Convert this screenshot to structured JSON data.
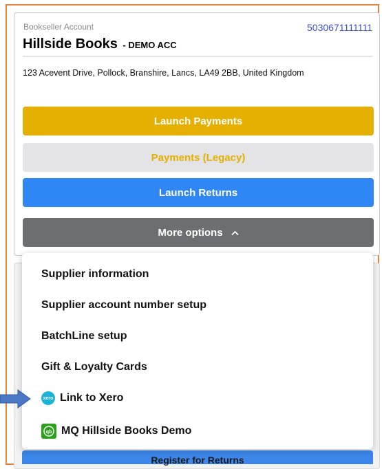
{
  "account": {
    "label": "Bookseller Account",
    "number": "5030671111111",
    "name": "Hillside Books",
    "demo_tag": "- DEMO ACC",
    "address": "123 Acevent Drive, Pollock, Branshire, Lancs, LA49 2BB, United Kingdom"
  },
  "buttons": {
    "launch_payments": "Launch Payments",
    "payments_legacy": "Payments (Legacy)",
    "launch_returns": "Launch Returns",
    "more_options": "More options",
    "more_options_icon": "chevron-up-icon"
  },
  "dropdown": {
    "items": [
      {
        "label": "Supplier information"
      },
      {
        "label": "Supplier account number setup"
      },
      {
        "label": "BatchLine setup"
      },
      {
        "label": "Gift & Loyalty Cards"
      },
      {
        "label": "Link to Xero",
        "icon": "xero-icon",
        "icon_text": "xero"
      },
      {
        "label": "MQ Hillside Books Demo",
        "icon": "quickbooks-icon",
        "icon_text": "qb"
      }
    ]
  },
  "partial_button_label": "Register for Returns",
  "colors": {
    "frame_border": "#e8823a",
    "payments": "#e6b000",
    "legacy_bg": "#e4e4e7",
    "returns": "#2f86f5",
    "more_options": "#6d6e72",
    "account_number": "#3a4fd0",
    "xero": "#1ab4d7",
    "quickbooks": "#2ca01c",
    "annotation_arrow": "#4a78c4"
  }
}
